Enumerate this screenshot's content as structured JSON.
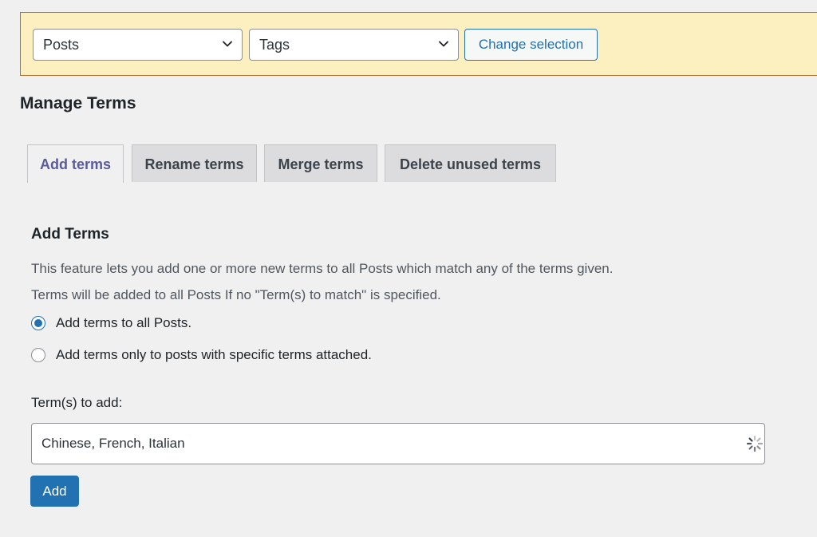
{
  "selection_bar": {
    "post_type_select": {
      "value": "Posts",
      "icon": "chevron-down-icon"
    },
    "taxonomy_select": {
      "value": "Tags",
      "icon": "chevron-down-icon"
    },
    "change_button_label": "Change selection"
  },
  "page_title": "Manage Terms",
  "tabs": [
    {
      "label": "Add terms",
      "active": true
    },
    {
      "label": "Rename terms",
      "active": false
    },
    {
      "label": "Merge terms",
      "active": false
    },
    {
      "label": "Delete unused terms",
      "active": false
    }
  ],
  "section": {
    "title": "Add Terms",
    "description_1": "This feature lets you add one or more new terms to all Posts which match any of the terms given.",
    "description_2": "Terms will be added to all Posts If no \"Term(s) to match\" is specified.",
    "options": [
      {
        "label": "Add terms to all Posts.",
        "checked": true
      },
      {
        "label": "Add terms only to posts with specific terms attached.",
        "checked": false
      }
    ],
    "field_label": "Term(s) to add:",
    "field_value": "Chinese, French, Italian",
    "spinner_icon": "loading-spinner-icon",
    "add_button_label": "Add"
  },
  "colors": {
    "accent": "#2271b1",
    "notice_background": "#fcf0c1",
    "notice_border": "#b06d2a",
    "page_background": "#f0f0f1",
    "active_tab_text": "#5b5b9c"
  }
}
